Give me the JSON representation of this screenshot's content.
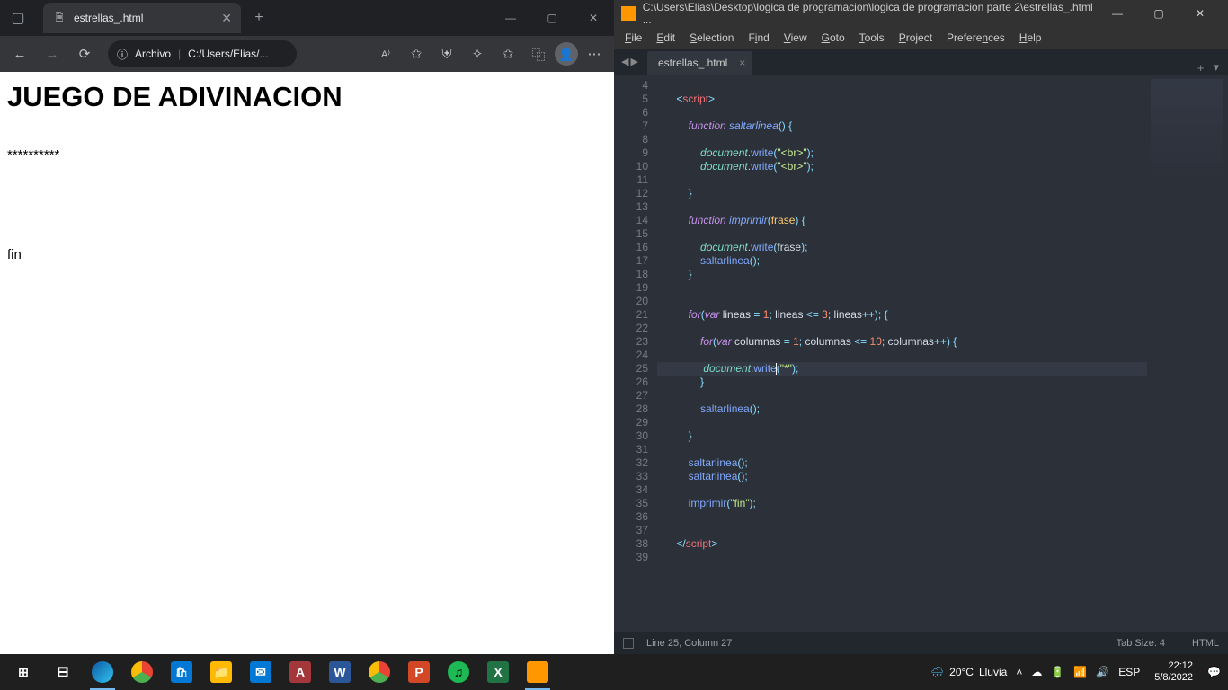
{
  "browser": {
    "tab_title": "estrellas_.html",
    "url_label": "Archivo",
    "url_path": "C:/Users/Elias/...",
    "content": {
      "heading": "JUEGO DE ADIVINACION",
      "stars": "**********",
      "fin": "fin"
    }
  },
  "sublime": {
    "title": "C:\\Users\\Elias\\Desktop\\logica de programacion\\logica de programacion parte 2\\estrellas_.html ...",
    "menu": {
      "file": "File",
      "edit": "Edit",
      "selection": "Selection",
      "find": "Find",
      "view": "View",
      "goto": "Goto",
      "tools": "Tools",
      "project": "Project",
      "preferences": "Preferences",
      "help": "Help"
    },
    "tab": "estrellas_.html",
    "status_pos": "Line 25, Column 27",
    "status_tab": "Tab Size: 4",
    "status_lang": "HTML",
    "lines": {
      "4": "",
      "5": {
        "indent": "    ",
        "tokens": [
          [
            "pun",
            "<"
          ],
          [
            "tag",
            "script"
          ],
          [
            "pun",
            ">"
          ]
        ]
      },
      "6": "",
      "7": {
        "indent": "        ",
        "tokens": [
          [
            "kw",
            "function"
          ],
          [
            "nm",
            " "
          ],
          [
            "fnd",
            "saltarlinea"
          ],
          [
            "pun",
            "("
          ],
          [
            "pun",
            ")"
          ],
          [
            "nm",
            " "
          ],
          [
            "pun",
            "{"
          ]
        ]
      },
      "8": "",
      "9": {
        "indent": "            ",
        "tokens": [
          [
            "obj",
            "document"
          ],
          [
            "pun",
            "."
          ],
          [
            "fn",
            "write"
          ],
          [
            "pun",
            "("
          ],
          [
            "str",
            "\"<br>\""
          ],
          [
            "pun",
            ")"
          ],
          [
            "pun",
            ";"
          ]
        ]
      },
      "10": {
        "indent": "            ",
        "tokens": [
          [
            "obj",
            "document"
          ],
          [
            "pun",
            "."
          ],
          [
            "fn",
            "write"
          ],
          [
            "pun",
            "("
          ],
          [
            "str",
            "\"<br>\""
          ],
          [
            "pun",
            ")"
          ],
          [
            "pun",
            ";"
          ]
        ]
      },
      "11": "",
      "12": {
        "indent": "        ",
        "tokens": [
          [
            "pun",
            "}"
          ]
        ]
      },
      "13": "",
      "14": {
        "indent": "        ",
        "tokens": [
          [
            "kw",
            "function"
          ],
          [
            "nm",
            " "
          ],
          [
            "fnd",
            "imprimir"
          ],
          [
            "pun",
            "("
          ],
          [
            "par",
            "frase"
          ],
          [
            "pun",
            ")"
          ],
          [
            "nm",
            " "
          ],
          [
            "pun",
            "{"
          ]
        ]
      },
      "15": "",
      "16": {
        "indent": "            ",
        "tokens": [
          [
            "obj",
            "document"
          ],
          [
            "pun",
            "."
          ],
          [
            "fn",
            "write"
          ],
          [
            "pun",
            "("
          ],
          [
            "nm",
            "frase"
          ],
          [
            "pun",
            ")"
          ],
          [
            "pun",
            ";"
          ]
        ]
      },
      "17": {
        "indent": "            ",
        "tokens": [
          [
            "fn",
            "saltarlinea"
          ],
          [
            "pun",
            "("
          ],
          [
            "pun",
            ")"
          ],
          [
            "pun",
            ";"
          ]
        ]
      },
      "18": {
        "indent": "        ",
        "tokens": [
          [
            "pun",
            "}"
          ]
        ]
      },
      "19": "",
      "20": "",
      "21": {
        "indent": "        ",
        "tokens": [
          [
            "kw",
            "for"
          ],
          [
            "pun",
            "("
          ],
          [
            "kw",
            "var"
          ],
          [
            "nm",
            " lineas "
          ],
          [
            "op",
            "="
          ],
          [
            "nm",
            " "
          ],
          [
            "num",
            "1"
          ],
          [
            "pun",
            ";"
          ],
          [
            "nm",
            " lineas "
          ],
          [
            "op",
            "<="
          ],
          [
            "nm",
            " "
          ],
          [
            "num",
            "3"
          ],
          [
            "pun",
            ";"
          ],
          [
            "nm",
            " lineas"
          ],
          [
            "op",
            "++"
          ],
          [
            "pun",
            ")"
          ],
          [
            "pun",
            ";"
          ],
          [
            "nm",
            " "
          ],
          [
            "pun",
            "{"
          ]
        ]
      },
      "22": "",
      "23": {
        "indent": "            ",
        "tokens": [
          [
            "kw",
            "for"
          ],
          [
            "pun",
            "("
          ],
          [
            "kw",
            "var"
          ],
          [
            "nm",
            " columnas "
          ],
          [
            "op",
            "="
          ],
          [
            "nm",
            " "
          ],
          [
            "num",
            "1"
          ],
          [
            "pun",
            ";"
          ],
          [
            "nm",
            " columnas "
          ],
          [
            "op",
            "<="
          ],
          [
            "nm",
            " "
          ],
          [
            "num",
            "10"
          ],
          [
            "pun",
            ";"
          ],
          [
            "nm",
            " columnas"
          ],
          [
            "op",
            "++"
          ],
          [
            "pun",
            ")"
          ],
          [
            "nm",
            " "
          ],
          [
            "pun",
            "{"
          ]
        ]
      },
      "24": "",
      "25": {
        "indent": "             ",
        "tokens": [
          [
            "obj",
            "document"
          ],
          [
            "pun",
            "."
          ],
          [
            "fn",
            "write"
          ],
          [
            "cursor",
            ""
          ],
          [
            "pun",
            "("
          ],
          [
            "str",
            "\"*\""
          ],
          [
            "pun",
            ")"
          ],
          [
            "pun",
            ";"
          ]
        ]
      },
      "26": {
        "indent": "            ",
        "tokens": [
          [
            "pun",
            "}"
          ]
        ]
      },
      "27": "",
      "28": {
        "indent": "            ",
        "tokens": [
          [
            "fn",
            "saltarlinea"
          ],
          [
            "pun",
            "("
          ],
          [
            "pun",
            ")"
          ],
          [
            "pun",
            ";"
          ]
        ]
      },
      "29": "",
      "30": {
        "indent": "        ",
        "tokens": [
          [
            "pun",
            "}"
          ]
        ]
      },
      "31": "",
      "32": {
        "indent": "        ",
        "tokens": [
          [
            "fn",
            "saltarlinea"
          ],
          [
            "pun",
            "("
          ],
          [
            "pun",
            ")"
          ],
          [
            "pun",
            ";"
          ]
        ]
      },
      "33": {
        "indent": "        ",
        "tokens": [
          [
            "fn",
            "saltarlinea"
          ],
          [
            "pun",
            "("
          ],
          [
            "pun",
            ")"
          ],
          [
            "pun",
            ";"
          ]
        ]
      },
      "34": "",
      "35": {
        "indent": "        ",
        "tokens": [
          [
            "fn",
            "imprimir"
          ],
          [
            "pun",
            "("
          ],
          [
            "str",
            "\"fin\""
          ],
          [
            "pun",
            ")"
          ],
          [
            "pun",
            ";"
          ]
        ]
      },
      "36": "",
      "37": "",
      "38": {
        "indent": "    ",
        "tokens": [
          [
            "pun",
            "</"
          ],
          [
            "tag",
            "script"
          ],
          [
            "pun",
            ">"
          ]
        ]
      },
      "39": ""
    },
    "modified_lines": [
      5,
      7,
      9,
      10,
      11,
      12,
      14,
      16,
      17,
      18,
      21,
      23,
      25,
      26,
      28,
      30,
      32,
      33,
      35,
      38
    ],
    "highlight_line": 25
  },
  "taskbar": {
    "weather_temp": "20°C",
    "weather_desc": "Lluvia",
    "lang": "ESP",
    "time": "22:12",
    "date": "5/8/2022"
  }
}
